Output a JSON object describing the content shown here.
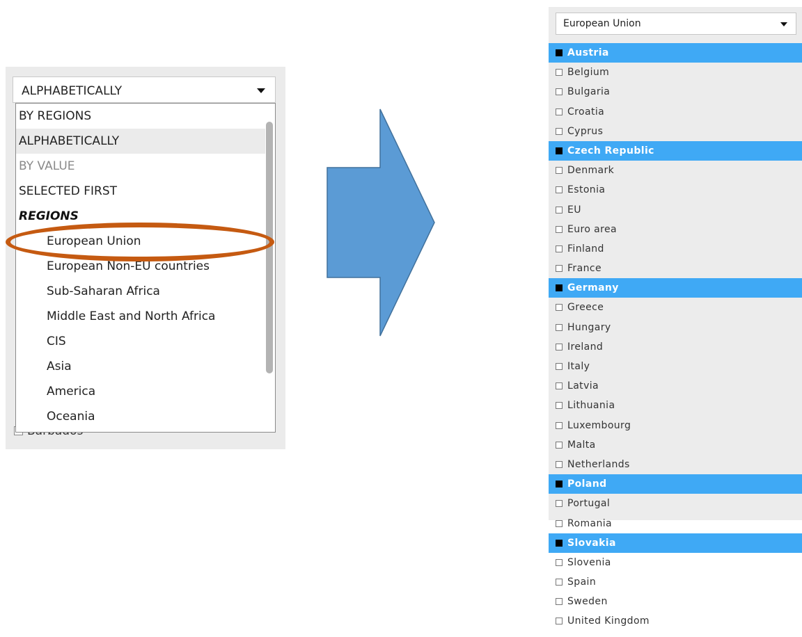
{
  "left": {
    "select_value": "ALPHABETICALLY",
    "behind_item": "Barbados",
    "options": [
      {
        "label": "BY REGIONS",
        "kind": "plain"
      },
      {
        "label": "ALPHABETICALLY",
        "kind": "selected"
      },
      {
        "label": "BY VALUE",
        "kind": "dim"
      },
      {
        "label": "SELECTED FIRST",
        "kind": "plain"
      },
      {
        "label": "REGIONS",
        "kind": "header"
      },
      {
        "label": "European Union",
        "kind": "sub"
      },
      {
        "label": "European Non-EU countries",
        "kind": "sub"
      },
      {
        "label": "Sub-Saharan Africa",
        "kind": "sub"
      },
      {
        "label": "Middle East and North Africa",
        "kind": "sub"
      },
      {
        "label": "CIS",
        "kind": "sub"
      },
      {
        "label": "Asia",
        "kind": "sub"
      },
      {
        "label": "America",
        "kind": "sub"
      },
      {
        "label": "Oceania",
        "kind": "sub"
      }
    ]
  },
  "right": {
    "select_value": "European Union",
    "countries": [
      {
        "name": "Austria",
        "selected": true
      },
      {
        "name": "Belgium",
        "selected": false
      },
      {
        "name": "Bulgaria",
        "selected": false
      },
      {
        "name": "Croatia",
        "selected": false
      },
      {
        "name": "Cyprus",
        "selected": false
      },
      {
        "name": "Czech Republic",
        "selected": true
      },
      {
        "name": "Denmark",
        "selected": false
      },
      {
        "name": "Estonia",
        "selected": false
      },
      {
        "name": "EU",
        "selected": false
      },
      {
        "name": "Euro area",
        "selected": false
      },
      {
        "name": "Finland",
        "selected": false
      },
      {
        "name": "France",
        "selected": false
      },
      {
        "name": "Germany",
        "selected": true
      },
      {
        "name": "Greece",
        "selected": false
      },
      {
        "name": "Hungary",
        "selected": false
      },
      {
        "name": "Ireland",
        "selected": false
      },
      {
        "name": "Italy",
        "selected": false
      },
      {
        "name": "Latvia",
        "selected": false
      },
      {
        "name": "Lithuania",
        "selected": false
      },
      {
        "name": "Luxembourg",
        "selected": false
      },
      {
        "name": "Malta",
        "selected": false
      },
      {
        "name": "Netherlands",
        "selected": false
      },
      {
        "name": "Poland",
        "selected": true
      },
      {
        "name": "Portugal",
        "selected": false
      },
      {
        "name": "Romania",
        "selected": false
      },
      {
        "name": "Slovakia",
        "selected": true
      },
      {
        "name": "Slovenia",
        "selected": false
      },
      {
        "name": "Spain",
        "selected": false
      },
      {
        "name": "Sweden",
        "selected": false
      },
      {
        "name": "United Kingdom",
        "selected": false
      }
    ]
  },
  "colors": {
    "selected_row": "#3fa9f5",
    "highlight_ellipse": "#c55a11",
    "arrow_fill": "#5b9bd5",
    "arrow_stroke": "#41719c"
  }
}
